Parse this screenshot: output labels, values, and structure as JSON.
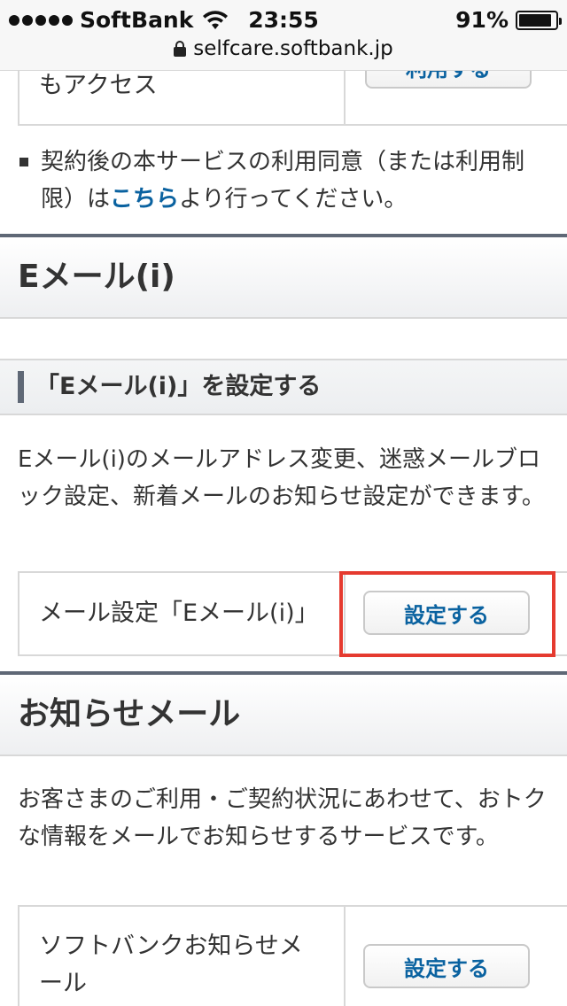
{
  "status": {
    "carrier": "SoftBank",
    "time": "23:55",
    "battery": "91%",
    "battery_level": 0.91,
    "url": "selfcare.softbank.jp"
  },
  "top_row": {
    "label": "もアクセス",
    "button": "利用する"
  },
  "notice": {
    "before": "契約後の本サービスの利用同意（または利用制限）は",
    "link": "こちら",
    "after": "より行ってください。"
  },
  "email_section": {
    "title": "Eメール(i)",
    "subtitle": "「Eメール(i)」を設定する",
    "description": "Eメール(i)のメールアドレス変更、迷惑メールブロック設定、新着メールのお知らせ設定ができます。",
    "row_label": "メール設定「Eメール(i)」",
    "row_button": "設定する"
  },
  "notify_section": {
    "title": "お知らせメール",
    "description": "お客さまのご利用・ご契約状況にあわせて、おトクな情報をメールでお知らせするサービスです。",
    "row_label": "ソフトバンクお知らせメール",
    "row_button": "設定する"
  }
}
